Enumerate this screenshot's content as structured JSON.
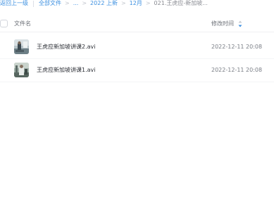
{
  "breadcrumb": {
    "back": "返回上一级",
    "all_files": "全部文件",
    "ellipsis": "...",
    "folder1": "2022 上新",
    "folder2": "12月",
    "current": "021.王虎应-新加坡..."
  },
  "table": {
    "col_name": "文件名",
    "col_time": "修改时间",
    "sort_icon": "sort-desc-icon",
    "rows": [
      {
        "name": "王虎应新加坡讲课2.avi",
        "time": "2022-12-11 20:08",
        "thumb": "video-thumbnail"
      },
      {
        "name": "王虎应新加坡讲课1.avi",
        "time": "2022-12-11 20:08",
        "thumb": "video-thumbnail"
      }
    ]
  },
  "colors": {
    "link": "#3b8fe0",
    "sort_accent": "#3b8fe0"
  }
}
